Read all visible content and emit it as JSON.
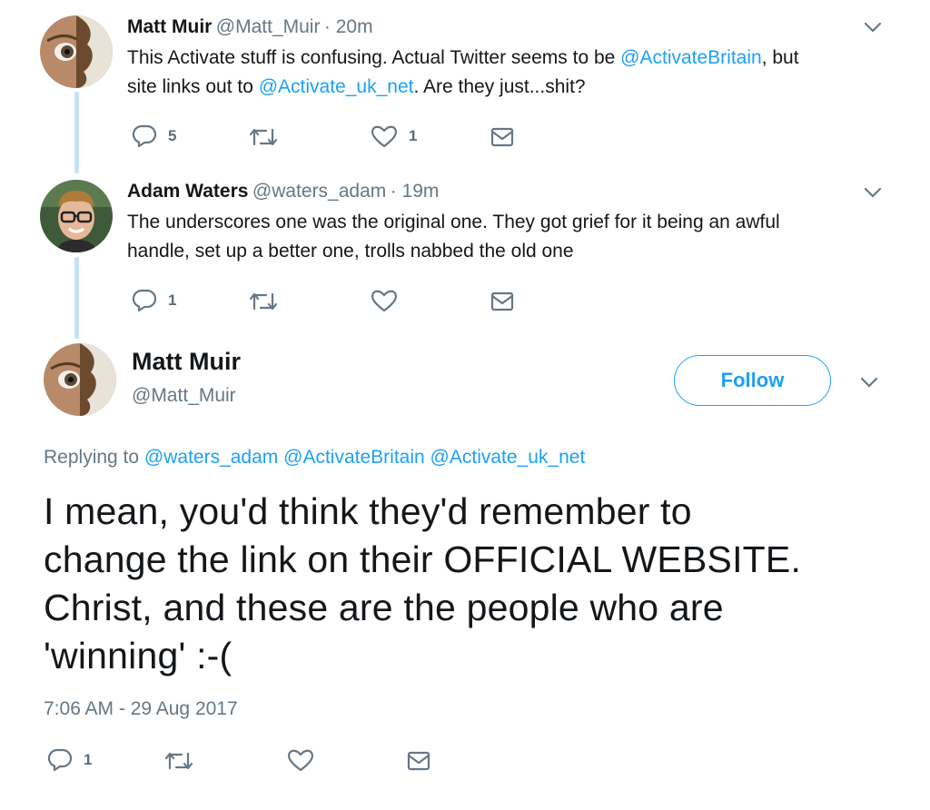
{
  "tweets": [
    {
      "name": "Matt Muir",
      "handle": "@Matt_Muir",
      "time": "· 20m",
      "text_parts": [
        "This Activate stuff is confusing. Actual Twitter seems to be ",
        "@ActivateBritain",
        ", but",
        "site links out to ",
        "@Activate_uk_net",
        ". Are they just...shit?"
      ],
      "reply_count": "5",
      "retweet_count": "",
      "like_count": "1"
    },
    {
      "name": "Adam Waters",
      "handle": "@waters_adam",
      "time": "· 19m",
      "text_line1": "The underscores one was the original one. They got grief for it being an awful",
      "text_line2": "handle, set up a better one, trolls nabbed the old one",
      "reply_count": "1",
      "retweet_count": "",
      "like_count": ""
    }
  ],
  "main": {
    "name": "Matt Muir",
    "handle": "@Matt_Muir",
    "follow_label": "Follow",
    "replying_prefix": "Replying to",
    "replying_to": [
      "@waters_adam",
      "@ActivateBritain",
      "@Activate_uk_net"
    ],
    "text_lines": [
      "I mean, you'd think they'd remember to",
      "change the link on their OFFICIAL WEBSITE.",
      "Christ, and these are the people who are",
      "'winning' :-("
    ],
    "timestamp": "7:06 AM - 29 Aug 2017",
    "reply_count": "1"
  },
  "colors": {
    "link": "#1da1f2",
    "muted": "#657786",
    "thread_line": "#c4e3f9"
  },
  "icons": [
    "reply-icon",
    "retweet-icon",
    "like-icon",
    "message-icon",
    "chevron-down-icon"
  ]
}
